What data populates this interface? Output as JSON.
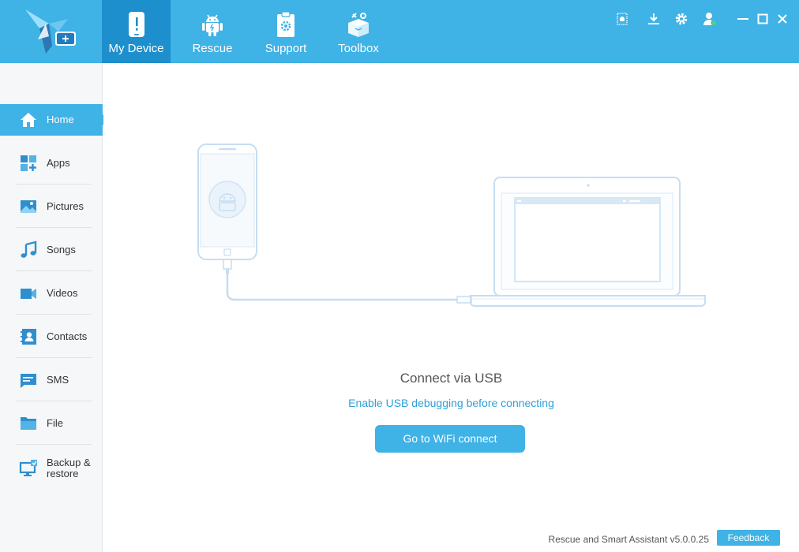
{
  "header": {
    "tabs": [
      {
        "label": "My Device",
        "icon": "phone-alert-icon",
        "active": true
      },
      {
        "label": "Rescue",
        "icon": "android-icon",
        "active": false
      },
      {
        "label": "Support",
        "icon": "clipboard-gear-icon",
        "active": false
      },
      {
        "label": "Toolbox",
        "icon": "toolbox-icon",
        "active": false
      }
    ],
    "window_icons": [
      "notification-icon",
      "download-icon",
      "settings-icon",
      "user-icon",
      "minimize-icon",
      "maximize-icon",
      "close-icon"
    ]
  },
  "sidebar": {
    "items": [
      {
        "label": "Home",
        "icon": "home-icon",
        "active": true
      },
      {
        "label": "Apps",
        "icon": "apps-icon"
      },
      {
        "label": "Pictures",
        "icon": "pictures-icon"
      },
      {
        "label": "Songs",
        "icon": "music-note-icon"
      },
      {
        "label": "Videos",
        "icon": "video-camera-icon"
      },
      {
        "label": "Contacts",
        "icon": "contacts-icon"
      },
      {
        "label": "SMS",
        "icon": "sms-icon"
      },
      {
        "label": "File",
        "icon": "folder-icon"
      },
      {
        "label": "Backup & restore",
        "icon": "backup-icon"
      }
    ]
  },
  "main": {
    "connect_title": "Connect via USB",
    "connect_hint": "Enable USB debugging before connecting",
    "wifi_button": "Go to WiFi connect"
  },
  "footer": {
    "version": "Rescue and Smart Assistant v5.0.0.25",
    "feedback": "Feedback"
  },
  "colors": {
    "header": "#3fb2e6",
    "active_tab": "#1d8fcc",
    "accent": "#3fb2e6",
    "sidebar_bg": "#f5f7f9",
    "illustration_line": "#c6ddf2"
  }
}
